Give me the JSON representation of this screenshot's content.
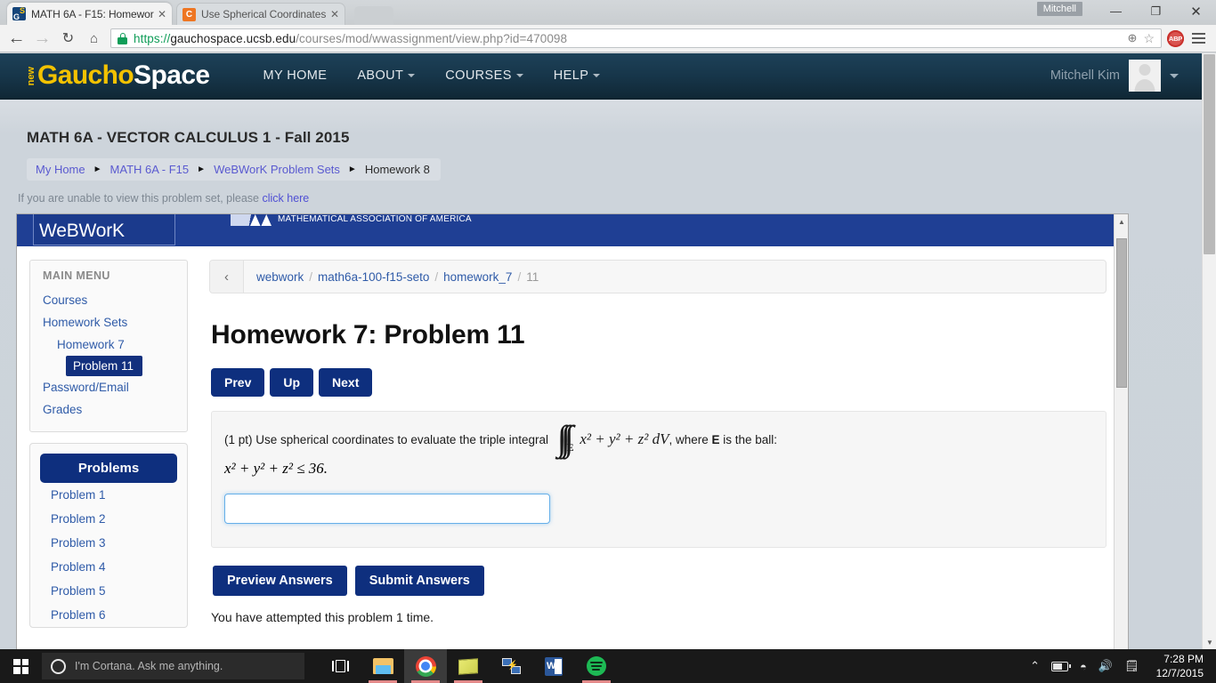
{
  "window": {
    "user_chip": "Mitchell",
    "minimize": "—",
    "maximize": "❐",
    "close": "✕"
  },
  "tabs": [
    {
      "title": "MATH 6A - F15: Homewor",
      "favicon": "gauchospace-favicon",
      "close": "✕",
      "active": true
    },
    {
      "title": "Use Spherical Coordinates",
      "favicon": "chegg-favicon",
      "close": "✕",
      "active": false
    }
  ],
  "toolbar": {
    "back_icon": "←",
    "forward_icon": "→",
    "reload_icon": "↻",
    "home_icon": "⌂",
    "zoom_icon": "⊕",
    "star_icon": "☆",
    "adblock_label": "ABP",
    "menu_icon": "hamburger-menu-icon",
    "url": {
      "scheme": "https://",
      "host": "gauchospace.ucsb.edu",
      "path": "/courses/mod/wwassignment/view.php?id=470098"
    }
  },
  "gauchospace": {
    "logo": {
      "new": "new",
      "gaucho": "Gaucho",
      "space": "Space"
    },
    "menu": [
      {
        "label": "MY HOME",
        "has_caret": false
      },
      {
        "label": "ABOUT",
        "has_caret": true
      },
      {
        "label": "COURSES",
        "has_caret": true
      },
      {
        "label": "HELP",
        "has_caret": true
      }
    ],
    "user_name": "Mitchell Kim",
    "course_title": "MATH 6A - VECTOR CALCULUS 1 - Fall 2015",
    "breadcrumb": [
      {
        "label": "My Home",
        "link": true
      },
      {
        "label": "MATH 6A - F15",
        "link": true
      },
      {
        "label": "WeBWorK Problem Sets",
        "link": true
      },
      {
        "label": "Homework 8",
        "link": false
      }
    ],
    "breadcrumb_sep": "►",
    "notice_text": "If you are unable to view this problem set, please ",
    "notice_link": "click here"
  },
  "webwork": {
    "logo": "WeBWorK",
    "maa_text": "MATHEMATICAL ASSOCIATION OF AMERICA",
    "sidebar": {
      "main_menu_title": "MAIN MENU",
      "items": [
        {
          "label": "Courses",
          "level": 1,
          "selected": false
        },
        {
          "label": "Homework Sets",
          "level": 1,
          "selected": false
        },
        {
          "label": "Homework 7",
          "level": 2,
          "selected": false
        },
        {
          "label": "Problem 11",
          "level": 3,
          "selected": true
        },
        {
          "label": "Password/Email",
          "level": 1,
          "selected": false
        },
        {
          "label": "Grades",
          "level": 1,
          "selected": false
        }
      ],
      "problems_button": "Problems",
      "problems": [
        "Problem 1",
        "Problem 2",
        "Problem 3",
        "Problem 4",
        "Problem 5",
        "Problem 6"
      ]
    },
    "content": {
      "back_icon": "‹",
      "crumbs": [
        {
          "label": "webwork",
          "link": true
        },
        {
          "label": "math6a-100-f15-seto",
          "link": true
        },
        {
          "label": "homework_7",
          "link": true
        },
        {
          "label": "11",
          "link": false
        }
      ],
      "crumb_sep": "/",
      "title": "Homework 7: Problem 11",
      "nav_buttons": [
        "Prev",
        "Up",
        "Next"
      ],
      "problem": {
        "points": "(1 pt)",
        "text_before": "Use spherical coordinates to evaluate the triple integral",
        "integral_symbol": "∫∫∫",
        "integral_subscript": "E",
        "integrand": "x² + y² + z² dV",
        "text_after_a": ", where ",
        "region_symbol": "E",
        "text_after_b": " is the ball:",
        "inequality": "x² + y² + z² ≤ 36.",
        "answer_value": "",
        "answer_placeholder": ""
      },
      "action_buttons": [
        "Preview Answers",
        "Submit Answers"
      ],
      "attempt_text": "You have attempted this problem 1 time."
    }
  },
  "taskbar": {
    "cortana_placeholder": "I'm Cortana. Ask me anything.",
    "items": [
      {
        "name": "task-view",
        "running": false,
        "active": false
      },
      {
        "name": "file-explorer",
        "running": true,
        "active": false
      },
      {
        "name": "google-chrome",
        "running": true,
        "active": true
      },
      {
        "name": "sticky-notes",
        "running": true,
        "active": false
      },
      {
        "name": "remote-desktop",
        "running": false,
        "active": false
      },
      {
        "name": "microsoft-word",
        "running": false,
        "active": false
      },
      {
        "name": "spotify",
        "running": true,
        "active": false
      }
    ],
    "tray": {
      "chevron": "⌃",
      "wifi": "◠",
      "volume": "🔊",
      "action_center": "☰"
    },
    "clock_time": "7:28 PM",
    "clock_date": "12/7/2015"
  },
  "colors": {
    "webwork_blue": "#1f3f94",
    "button_navy": "#0e2f7e",
    "gauchospace_yellow": "#f3c200",
    "link_blue": "#2f5ba8",
    "focus_blue": "#66afe9"
  }
}
